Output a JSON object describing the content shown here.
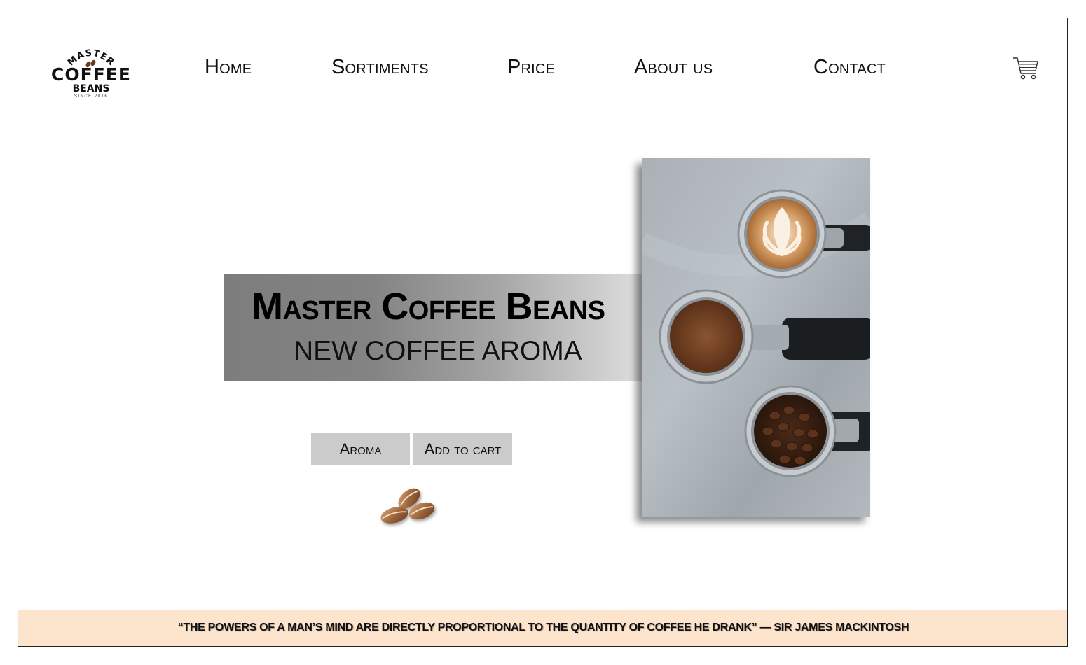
{
  "brand": {
    "arc_text": "MASTER",
    "name": "COFFEE",
    "sub": "BEANS",
    "since": "SINCE 2016"
  },
  "nav": {
    "home": "Home",
    "sortiments": "Sortiments",
    "price": "Price",
    "about": "About us",
    "contact": "Contact"
  },
  "icons": {
    "cart": "shopping-cart-icon",
    "beans": "coffee-beans-icon"
  },
  "hero": {
    "title": "Master Coffee Beans",
    "subtitle": "NEW COFFEE AROMA",
    "aroma_button": "Aroma",
    "cart_button": "Add to cart"
  },
  "colors": {
    "footer_bg": "#fde4cc",
    "button_bg": "#cbcbcb",
    "banner_start": "#7d7d7d",
    "banner_end": "#dedede"
  },
  "footer": {
    "quote": "“THE POWERS OF A MAN’S MIND ARE DIRECTLY PROPORTIONAL TO THE QUANTITY OF COFFEE HE DRANK” — SIR JAMES MACKINTOSH"
  }
}
